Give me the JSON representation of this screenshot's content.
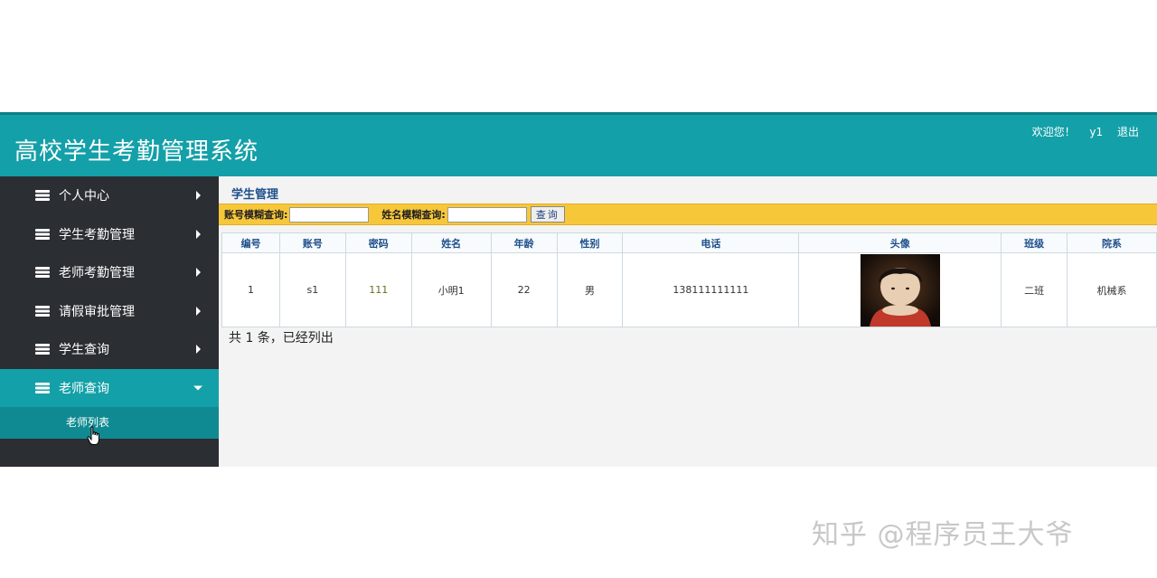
{
  "header": {
    "app_title": "高校学生考勤管理系统",
    "welcome": "欢迎您！",
    "username": "y1",
    "logout": "退出"
  },
  "sidebar": {
    "items": [
      {
        "label": "个人中心"
      },
      {
        "label": "学生考勤管理"
      },
      {
        "label": "老师考勤管理"
      },
      {
        "label": "请假审批管理"
      },
      {
        "label": "学生查询"
      },
      {
        "label": "老师查询"
      }
    ],
    "submenu": [
      {
        "label": "老师列表"
      }
    ]
  },
  "main": {
    "breadcrumb": "学生管理",
    "search": {
      "account_label": "账号模糊查询:",
      "name_label": "姓名模糊查询:",
      "account_value": "",
      "name_value": "",
      "button": "查询"
    },
    "table": {
      "headers": [
        "编号",
        "账号",
        "密码",
        "姓名",
        "年龄",
        "性别",
        "电话",
        "头像",
        "班级",
        "院系"
      ],
      "rows": [
        [
          "1",
          "s1",
          "111",
          "小明1",
          "22",
          "男",
          "138111111111",
          "",
          "二班",
          "机械系"
        ]
      ]
    },
    "summary": "共 1 条，已经列出"
  },
  "watermark": "知乎 @程序员王大爷",
  "colors": {
    "header_bg": "#14a0a8",
    "sidebar_bg": "#2b2e33",
    "active_bg": "#14a0a8",
    "search_bar_bg": "#f7c73a"
  }
}
